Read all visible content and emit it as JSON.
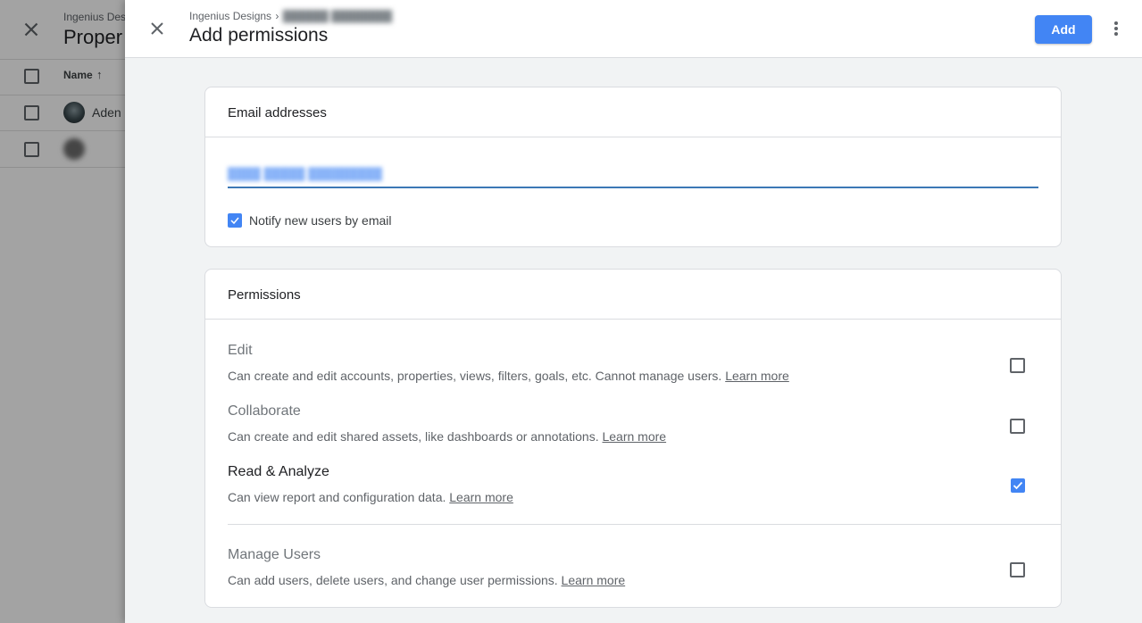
{
  "background": {
    "breadcrumb": "Ingenius Des",
    "title": "Proper",
    "table": {
      "column_name": "Name",
      "sort_icon": "arrow-up-icon",
      "rows": [
        {
          "name": "Aden ."
        },
        {
          "name": ""
        }
      ]
    }
  },
  "panel": {
    "breadcrumb_account": "Ingenius Designs",
    "breadcrumb_separator": "›",
    "title": "Add permissions",
    "add_label": "Add",
    "close_icon": "close-icon",
    "more_icon": "more-vert-icon"
  },
  "email_section": {
    "title": "Email addresses",
    "input_value": "",
    "notify_label": "Notify new users by email",
    "notify_checked": true
  },
  "permissions_section": {
    "title": "Permissions",
    "items": [
      {
        "name": "Edit",
        "description": "Can create and edit accounts, properties, views, filters, goals, etc. Cannot manage users.",
        "link": "Learn more",
        "checked": false
      },
      {
        "name": "Collaborate",
        "description": "Can create and edit shared assets, like dashboards or annotations.",
        "link": "Learn more",
        "checked": false
      },
      {
        "name": "Read & Analyze",
        "description": "Can view report and configuration data.",
        "link": "Learn more",
        "checked": true
      },
      {
        "name": "Manage Users",
        "description": "Can add users, delete users, and change user permissions.",
        "link": "Learn more",
        "checked": false
      }
    ]
  },
  "colors": {
    "accent": "#4285f4",
    "input_underline": "#3c78b5",
    "panel_background": "#f1f3f4"
  }
}
